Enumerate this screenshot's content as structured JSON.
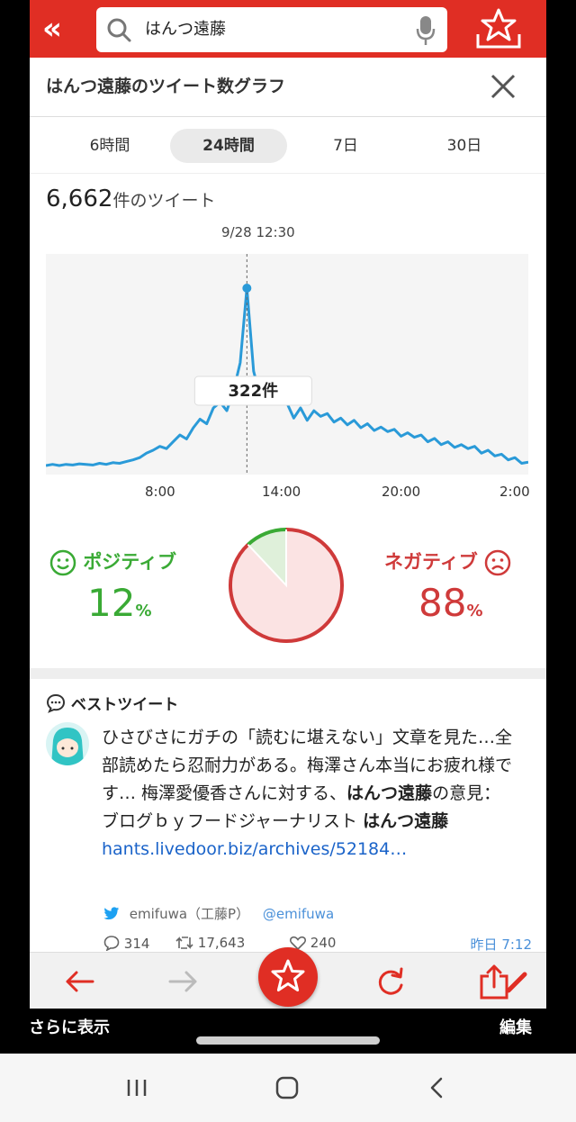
{
  "search": {
    "query": "はんつ遠藤"
  },
  "header": {
    "title": "はんつ遠藤のツイート数グラフ"
  },
  "tabs": [
    {
      "label": "6時間",
      "active": false
    },
    {
      "label": "24時間",
      "active": true
    },
    {
      "label": "7日",
      "active": false
    },
    {
      "label": "30日",
      "active": false
    }
  ],
  "summary": {
    "count": "6,662",
    "count_suffix": "件のツイート",
    "peak_time": "9/28 12:30",
    "peak_value": "322",
    "peak_suffix": "件"
  },
  "chart_data": {
    "type": "line",
    "x_tick_labels": [
      "8:00",
      "14:00",
      "20:00",
      "2:00"
    ],
    "title": "",
    "xlabel": "",
    "ylabel": "",
    "series": [
      {
        "values": [
          8,
          10,
          8,
          10,
          9,
          11,
          10,
          9,
          12,
          10,
          13,
          12,
          15,
          18,
          22,
          30,
          35,
          42,
          38,
          50,
          62,
          55,
          75,
          90,
          82,
          110,
          120,
          105,
          140,
          190,
          322,
          175,
          130,
          150,
          125,
          145,
          118,
          92,
          110,
          88,
          105,
          95,
          100,
          85,
          92,
          80,
          88,
          75,
          82,
          70,
          76,
          68,
          72,
          60,
          66,
          58,
          62,
          50,
          56,
          45,
          50,
          40,
          45,
          38,
          42,
          30,
          35,
          25,
          28,
          18,
          22,
          12,
          14
        ]
      }
    ],
    "peak": {
      "x_label": "9/28 12:30",
      "value": 322
    },
    "grid": false,
    "color": "#2a9ad8"
  },
  "sentiment": {
    "positive": {
      "label": "ポジティブ",
      "value": "12",
      "unit": "%",
      "fraction": 0.12,
      "color": "#3aaa35"
    },
    "negative": {
      "label": "ネガティブ",
      "value": "88",
      "unit": "%",
      "fraction": 0.88,
      "color": "#cf3a3a"
    }
  },
  "best_tweet": {
    "heading": "ベストツイート",
    "text_1": "ひさびさにガチの「読むに堪えない」文章を見た…全部読めたら忍耐力がある。梅澤さん本当にお疲れ様です… 梅澤愛優香さんに対する、",
    "bold_1": "はんつ遠藤",
    "text_2": "の意見：ブログｂｙフードジャーナリスト ",
    "bold_2": "はんつ遠藤",
    "link": "hants.livedoor.biz/archives/52184…",
    "author": "emifuwa（工藤P）",
    "handle": "@emifuwa",
    "replies": "314",
    "retweets": "17,643",
    "likes": "240",
    "time": "昨日 7:12"
  },
  "bottom_labels": {
    "more": "さらに表示",
    "edit": "編集"
  }
}
